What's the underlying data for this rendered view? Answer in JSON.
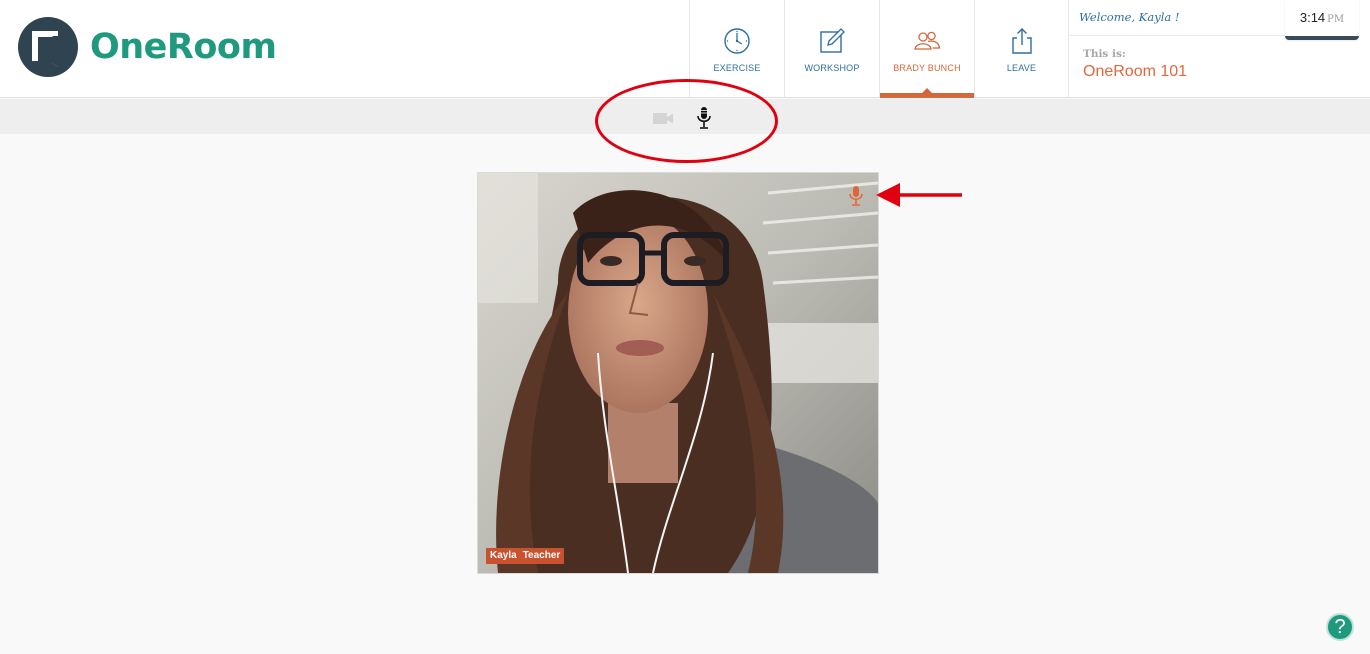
{
  "app": {
    "name": "OneRoom"
  },
  "nav": {
    "items": [
      {
        "label": "EXERCISE",
        "icon": "clock-icon",
        "active": false
      },
      {
        "label": "WORKSHOP",
        "icon": "edit-icon",
        "active": false
      },
      {
        "label": "BRADY BUNCH",
        "icon": "group-icon",
        "active": true
      },
      {
        "label": "LEAVE",
        "icon": "share-icon",
        "active": false
      }
    ]
  },
  "user": {
    "welcome": "Welcome, Kayla !"
  },
  "room": {
    "prefix": "This is:",
    "name": "OneRoom 101"
  },
  "clock": {
    "time": "3:14",
    "ampm": "PM"
  },
  "media_controls": {
    "camera": {
      "icon": "video-camera-icon",
      "state": "off"
    },
    "microphone": {
      "icon": "microphone-icon",
      "state": "on"
    }
  },
  "video_tile": {
    "participant_name": "Kayla",
    "participant_role": "Teacher",
    "mic_icon": "microphone-icon"
  },
  "help": {
    "label": "?"
  },
  "colors": {
    "brand_green": "#1f9a7f",
    "nav_blue": "#2d6fa3",
    "accent_orange": "#d4683b",
    "annotation_red": "#e0000f"
  }
}
